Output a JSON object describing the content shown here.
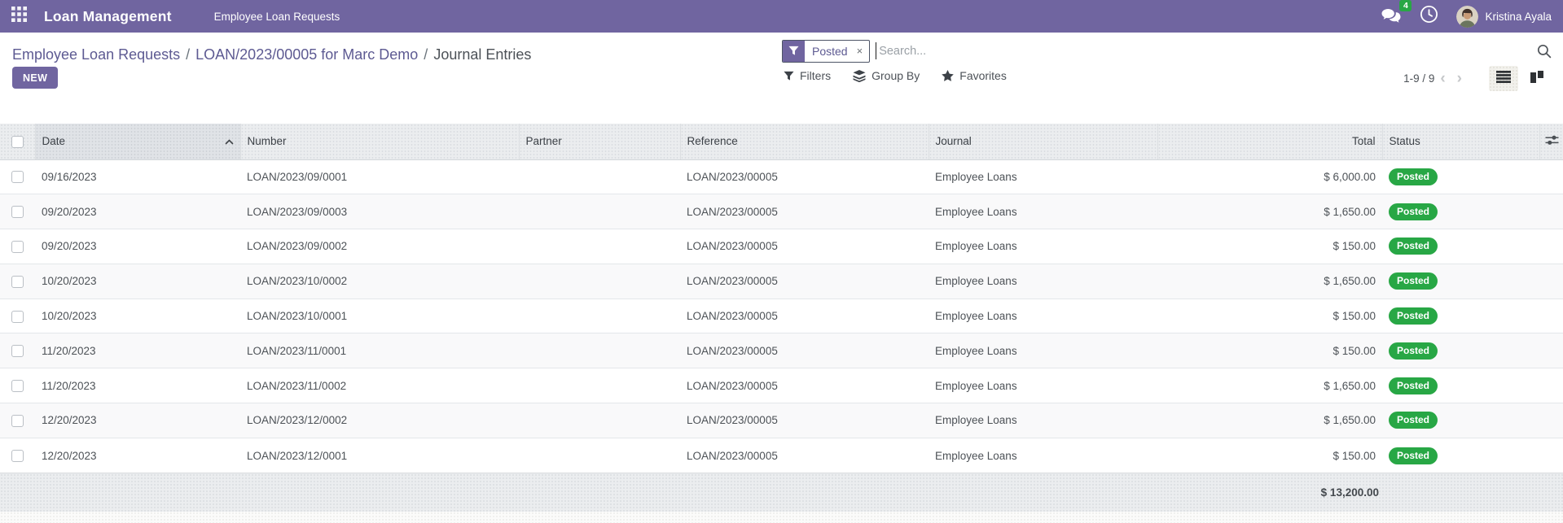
{
  "navbar": {
    "app_name": "Loan Management",
    "menu_item": "Employee Loan Requests",
    "messages_badge": "4",
    "user_name": "Kristina Ayala"
  },
  "breadcrumb": {
    "items": [
      "Employee Loan Requests",
      "LOAN/2023/00005 for Marc Demo",
      "Journal Entries"
    ],
    "separator": "/"
  },
  "search": {
    "facet": {
      "label": "Posted",
      "remove": "×"
    },
    "placeholder": "Search..."
  },
  "controls": {
    "new_button": "NEW",
    "filters": "Filters",
    "group_by": "Group By",
    "favorites": "Favorites",
    "pager": "1-9 / 9"
  },
  "table": {
    "columns": [
      "Date",
      "Number",
      "Partner",
      "Reference",
      "Journal",
      "Total",
      "Status"
    ],
    "sort_column": "Date",
    "sort_direction": "asc",
    "rows": [
      {
        "date": "09/16/2023",
        "number": "LOAN/2023/09/0001",
        "partner": "",
        "reference": "LOAN/2023/00005",
        "journal": "Employee Loans",
        "total": "$ 6,000.00",
        "status": "Posted"
      },
      {
        "date": "09/20/2023",
        "number": "LOAN/2023/09/0003",
        "partner": "",
        "reference": "LOAN/2023/00005",
        "journal": "Employee Loans",
        "total": "$ 1,650.00",
        "status": "Posted"
      },
      {
        "date": "09/20/2023",
        "number": "LOAN/2023/09/0002",
        "partner": "",
        "reference": "LOAN/2023/00005",
        "journal": "Employee Loans",
        "total": "$ 150.00",
        "status": "Posted"
      },
      {
        "date": "10/20/2023",
        "number": "LOAN/2023/10/0002",
        "partner": "",
        "reference": "LOAN/2023/00005",
        "journal": "Employee Loans",
        "total": "$ 1,650.00",
        "status": "Posted"
      },
      {
        "date": "10/20/2023",
        "number": "LOAN/2023/10/0001",
        "partner": "",
        "reference": "LOAN/2023/00005",
        "journal": "Employee Loans",
        "total": "$ 150.00",
        "status": "Posted"
      },
      {
        "date": "11/20/2023",
        "number": "LOAN/2023/11/0001",
        "partner": "",
        "reference": "LOAN/2023/00005",
        "journal": "Employee Loans",
        "total": "$ 150.00",
        "status": "Posted"
      },
      {
        "date": "11/20/2023",
        "number": "LOAN/2023/11/0002",
        "partner": "",
        "reference": "LOAN/2023/00005",
        "journal": "Employee Loans",
        "total": "$ 1,650.00",
        "status": "Posted"
      },
      {
        "date": "12/20/2023",
        "number": "LOAN/2023/12/0002",
        "partner": "",
        "reference": "LOAN/2023/00005",
        "journal": "Employee Loans",
        "total": "$ 1,650.00",
        "status": "Posted"
      },
      {
        "date": "12/20/2023",
        "number": "LOAN/2023/12/0001",
        "partner": "",
        "reference": "LOAN/2023/00005",
        "journal": "Employee Loans",
        "total": "$ 150.00",
        "status": "Posted"
      }
    ],
    "footer_total": "$ 13,200.00"
  },
  "colors": {
    "navbar_bg": "#7065A0",
    "accent": "#7065A0",
    "link": "#5D5A92",
    "badge_green": "#28A745",
    "header_bg": "#EBEDEF",
    "text": "#4C5157"
  }
}
